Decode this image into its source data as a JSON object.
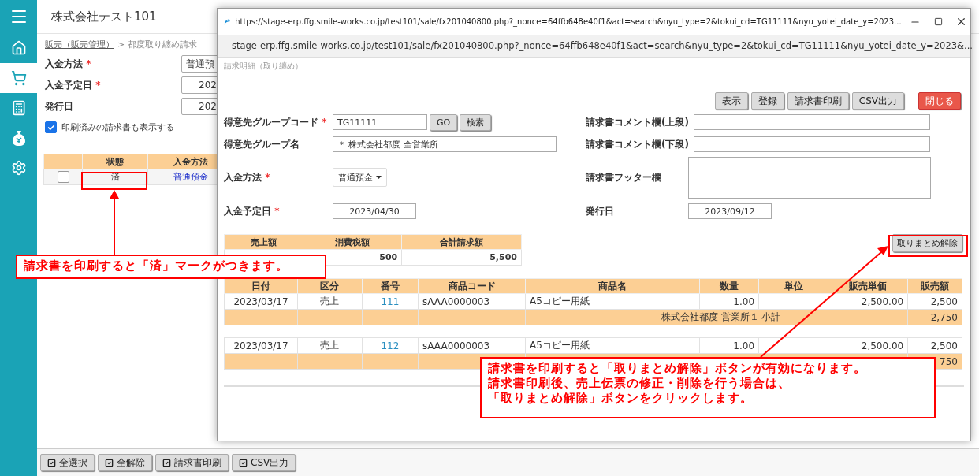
{
  "app": {
    "company": "株式会社テスト101",
    "required_mark": "*"
  },
  "sidebar": {
    "items": [
      {
        "kind": "home",
        "selected": false
      },
      {
        "kind": "cart",
        "selected": true
      },
      {
        "kind": "calculator",
        "selected": false
      },
      {
        "kind": "money",
        "selected": false
      },
      {
        "kind": "settings",
        "selected": false
      }
    ]
  },
  "breadcrumb": {
    "parent": "販売（販売管理）",
    "current": "> 都度取り纏め請求"
  },
  "search_form": {
    "fields": [
      {
        "label": "入金方法",
        "required": true,
        "value": "普通預"
      },
      {
        "label": "入金予定日",
        "required": true,
        "value": "202"
      },
      {
        "label": "発行日",
        "required": false,
        "value": "202"
      }
    ],
    "show_printed": {
      "label": "印刷済みの請求書も表示する",
      "checked": true
    }
  },
  "list_table": {
    "columns": [
      "状態",
      "入金方法"
    ],
    "rows": [
      {
        "checked": false,
        "status": "済",
        "method": "普通預金"
      }
    ]
  },
  "footer_buttons": [
    "全選択",
    "全解除",
    "請求書印刷",
    "CSV出力"
  ],
  "popup": {
    "title_url": "https://stage-erp.ffg.smile-works.co.jp/test101/sale/fx201040800.php?_nonce=64ffb648e40f1&act=search&nyu_type=2&tokui_cd=TG11111&nyu_yotei_date_y=2023...",
    "address": "stage-erp.ffg.smile-works.co.jp/test101/sale/fx201040800.php?_nonce=64ffb648e40f1&act=search&nyu_type=2&tokui_cd=TG11111&nyu_yotei_date_y=2023&...",
    "page_title": "請求明細（取り纏め）",
    "actions": [
      {
        "label": "表示",
        "kind": "normal"
      },
      {
        "label": "登録",
        "kind": "normal"
      },
      {
        "label": "請求書印刷",
        "kind": "normal"
      },
      {
        "label": "CSV出力",
        "kind": "normal"
      },
      {
        "label": "閉じる",
        "kind": "danger"
      }
    ],
    "left_fields": [
      {
        "label": "得意先グループコード",
        "required": true,
        "kind": "code",
        "value": "TG11111",
        "buttons": [
          "GO",
          "検索"
        ]
      },
      {
        "label": "得意先グループ名",
        "required": false,
        "kind": "text",
        "value": "＊ 株式会社都度  全営業所"
      },
      {
        "label": "入金方法",
        "required": true,
        "kind": "select",
        "value": "普通預金"
      },
      {
        "label": "入金予定日",
        "required": true,
        "kind": "date",
        "value": "2023/04/30"
      }
    ],
    "right_fields": [
      {
        "label": "請求書コメント欄(上段)",
        "kind": "text"
      },
      {
        "label": "請求書コメント欄(下段)",
        "kind": "text"
      },
      {
        "label": "請求書フッター欄",
        "kind": "textarea"
      },
      {
        "label": "発行日",
        "kind": "date",
        "value": "2023/09/12"
      }
    ],
    "summary": {
      "columns": [
        "売上額",
        "消費税額",
        "合計請求額"
      ],
      "tax": "500",
      "total": "5,500"
    },
    "unbundle_button": "取りまとめ解除",
    "detail": {
      "columns": [
        "日付",
        "区分",
        "番号",
        "商品コード",
        "商品名",
        "数量",
        "単位",
        "販売単価",
        "販売額"
      ],
      "groups": [
        {
          "rows": [
            {
              "date": "2023/03/17",
              "type": "売上",
              "number": "111",
              "code": "sAAA0000003",
              "name": "A5コピー用紙",
              "qty": "1.00",
              "price": "2,500.00",
              "amount": "2,500"
            }
          ],
          "subtotal": {
            "label": "株式会社都度  営業所１  小計",
            "amount": "2,750"
          }
        },
        {
          "rows": [
            {
              "date": "2023/03/17",
              "type": "売上",
              "number": "112",
              "code": "sAAA0000003",
              "name": "A5コピー用紙",
              "qty": "1.00",
              "price": "2,500.00",
              "amount": "2,500"
            }
          ],
          "subtotal": {
            "amount": "750"
          }
        }
      ]
    }
  },
  "annotations": [
    {
      "lines": [
        "請求書を印刷すると「済」マークがつきます。"
      ]
    },
    {
      "lines": [
        "請求書を印刷すると「取りまとめ解除」ボタンが有効になります。",
        "請求書印刷後、売上伝票の修正・削除を行う場合は、",
        "「取りまとめ解除」ボタンをクリックします。"
      ]
    }
  ]
}
